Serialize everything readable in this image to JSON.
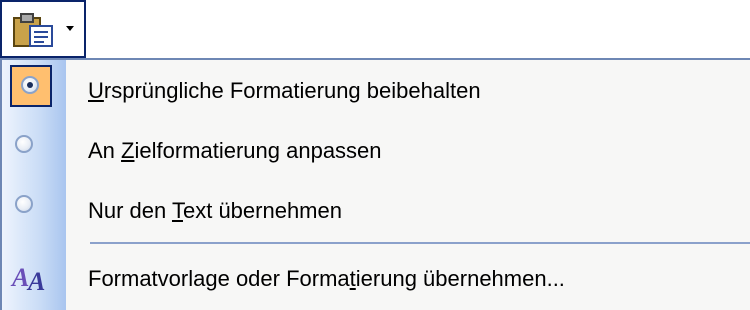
{
  "paste_button": {
    "icon": "clipboard-icon",
    "dropdown_icon": "chevron-down-icon"
  },
  "menu": {
    "items": [
      {
        "pre": "",
        "key": "U",
        "post": "rsprüngliche Formatierung beibehalten",
        "selected": true,
        "icon": "radio-checked-icon"
      },
      {
        "pre": "An ",
        "key": "Z",
        "post": "ielformatierung anpassen",
        "selected": false,
        "icon": "radio-icon"
      },
      {
        "pre": "Nur den ",
        "key": "T",
        "post": "ext übernehmen",
        "selected": false,
        "icon": "radio-icon"
      },
      {
        "pre": "Formatvorlage oder Forma",
        "key": "t",
        "post": "ierung übernehmen...",
        "selected": false,
        "icon": "styles-icon"
      }
    ]
  },
  "colors": {
    "border": "#0a246a",
    "highlight": "#ffbf6f",
    "gutter": "#c9dcf6",
    "separator": "#8ba1cb"
  }
}
